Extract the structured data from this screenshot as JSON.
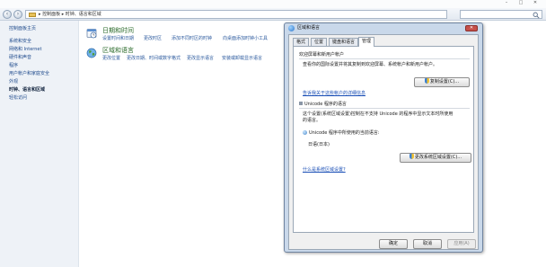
{
  "window": {
    "minimize": "–",
    "maximize": "□",
    "close": "✕"
  },
  "address": {
    "breadcrumb": "▸ 控制面板 ▸ 时钟、语言和区域"
  },
  "sidebar": {
    "items": [
      {
        "label": "控制面板主页",
        "current": false
      },
      {
        "label": "系统和安全",
        "current": false
      },
      {
        "label": "网络和 Internet",
        "current": false
      },
      {
        "label": "硬件和声音",
        "current": false
      },
      {
        "label": "程序",
        "current": false
      },
      {
        "label": "用户帐户和家庭安全",
        "current": false
      },
      {
        "label": "外观",
        "current": false
      },
      {
        "label": "时钟、语言和区域",
        "current": true
      },
      {
        "label": "轻松访问",
        "current": false
      }
    ]
  },
  "main": {
    "categories": [
      {
        "title": "日期和时间",
        "icon": "clock-icon",
        "links": [
          "设置时间和日期",
          "更改时区",
          "添加不同时区的时钟",
          "向桌面添加时钟小工具"
        ]
      },
      {
        "title": "区域和语言",
        "icon": "globe-icon",
        "links": [
          "更改位置",
          "更改日期、时间或数字格式",
          "更改显示语言",
          "安装或卸载显示语言"
        ]
      }
    ]
  },
  "dialog": {
    "title": "区域和语言",
    "close": "✕",
    "tabs": [
      "格式",
      "位置",
      "键盘和语言",
      "管理"
    ],
    "active_tab": 3,
    "welcome": {
      "heading": "欢迎屏幕和新用户帐户",
      "text": "查看你的国际设置并将其复制到欢迎屏幕、系统帐户和新用户帐户。",
      "button": "复制设置(C)...",
      "link": "告诉我关于这些帐户的详细信息"
    },
    "unicode": {
      "heading": "Unicode 程序的语言",
      "text1": "这个设置(系统区域设置)控制在不支持 Unicode 的程序中显示文本时所使用",
      "text2": "的语言。",
      "current_label": "Unicode 程序中所使用的当前语言:",
      "current_value": "日语(日本)",
      "button": "更改系统区域设置(C)...",
      "link": "什么是系统区域设置?"
    },
    "footer": {
      "ok": "确定",
      "cancel": "取消",
      "apply": "应用(A)"
    }
  }
}
